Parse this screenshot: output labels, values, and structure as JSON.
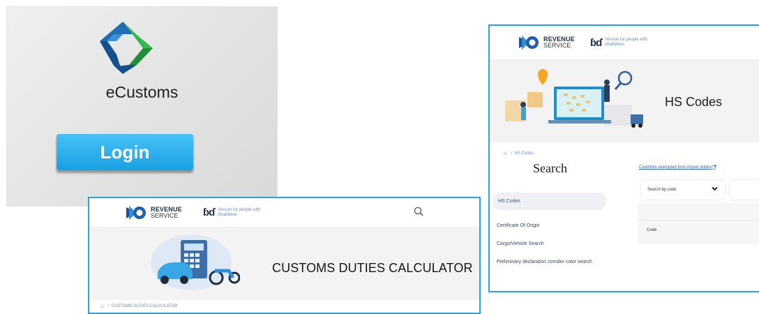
{
  "ecustoms": {
    "app_name": "eCustoms",
    "login_label": "Login",
    "logo_icon": "ecustoms-diamond-logo-icon",
    "colors": {
      "logo_blue": "#1b66a8",
      "logo_green": "#2db24a",
      "login_button": "#1aa0e2"
    }
  },
  "duties_window": {
    "brand": {
      "line1": "REVENUE",
      "line2": "SERVICE",
      "icon": "revenue-service-logo-icon"
    },
    "accessibility": {
      "icon": "glasses-icon",
      "text": "Version for people with disabilities"
    },
    "search_icon": "search-icon",
    "hero_title": "CUSTOMS DUTIES CALCULATOR",
    "breadcrumb": {
      "home_icon": "home-icon",
      "separator": "/",
      "current": "CUSTOMS DUTIES CALCULATOR"
    }
  },
  "hs_window": {
    "brand": {
      "line1": "REVENUE",
      "line2": "SERVICE",
      "icon": "revenue-service-logo-icon"
    },
    "accessibility": {
      "icon": "glasses-icon",
      "text": "Version for people with disabilities"
    },
    "hero_title": "HS Codes",
    "breadcrumb": {
      "home_icon": "home-icon",
      "separator": "/",
      "current": "HS Codes"
    },
    "search_heading": "Search",
    "sidebar": {
      "active": "HS Codes",
      "items": [
        "Certificate Of Origin",
        "Cargo/Vehicle Search",
        "Preliminary declaration corridor color search"
      ]
    },
    "countries_link": "Countries exempted from import duties",
    "search_by": "Search by code",
    "results_header": "Code"
  },
  "accent_color": "#2aa4d8"
}
